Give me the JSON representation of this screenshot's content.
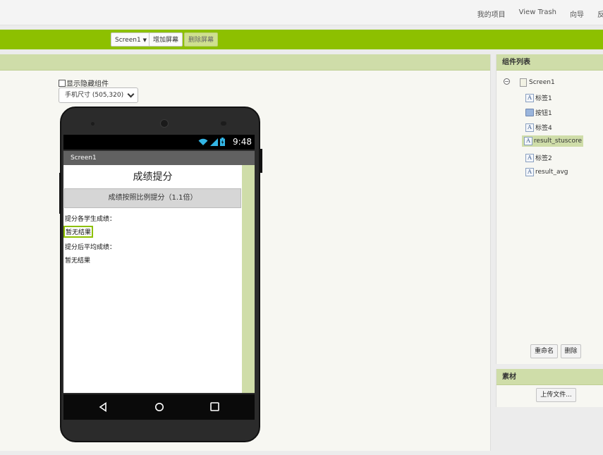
{
  "topnav": {
    "my_projects": "我的项目",
    "view_trash": "View Trash",
    "guide": "向导",
    "feedback": "反馈"
  },
  "toolbar": {
    "screen_select": "Screen1",
    "add_screen": "增加屏幕",
    "remove_screen": "删除屏幕"
  },
  "viewer": {
    "show_hidden_label": "显示隐藏组件",
    "size_select": "手机尺寸 (505,320)"
  },
  "phone": {
    "clock": "9:48",
    "screen_title": "Screen1",
    "app_title": "成绩提分",
    "app_button": "成绩按照比例提分（1.1倍）",
    "label1": "提分各学生成绩：",
    "result_stuscore": "暂无结果",
    "label2": "提分后平均成绩：",
    "result_avg": "暂无结果"
  },
  "components": {
    "title": "组件列表",
    "root": "Screen1",
    "items": [
      {
        "name": "标签1",
        "icon": "label-icon"
      },
      {
        "name": "按钮1",
        "icon": "button-icon"
      },
      {
        "name": "标签4",
        "icon": "label-icon"
      },
      {
        "name": "result_stuscore",
        "icon": "label-icon",
        "selected": true
      },
      {
        "name": "标签2",
        "icon": "label-icon"
      },
      {
        "name": "result_avg",
        "icon": "label-icon"
      }
    ],
    "rename_button": "重命名",
    "delete_button": "删除"
  },
  "media": {
    "title": "素材",
    "upload_button": "上传文件..."
  },
  "colors": {
    "toolbar_green": "#8dc000",
    "panel_header": "#cfdda9",
    "selection_border": "#8dc000"
  }
}
